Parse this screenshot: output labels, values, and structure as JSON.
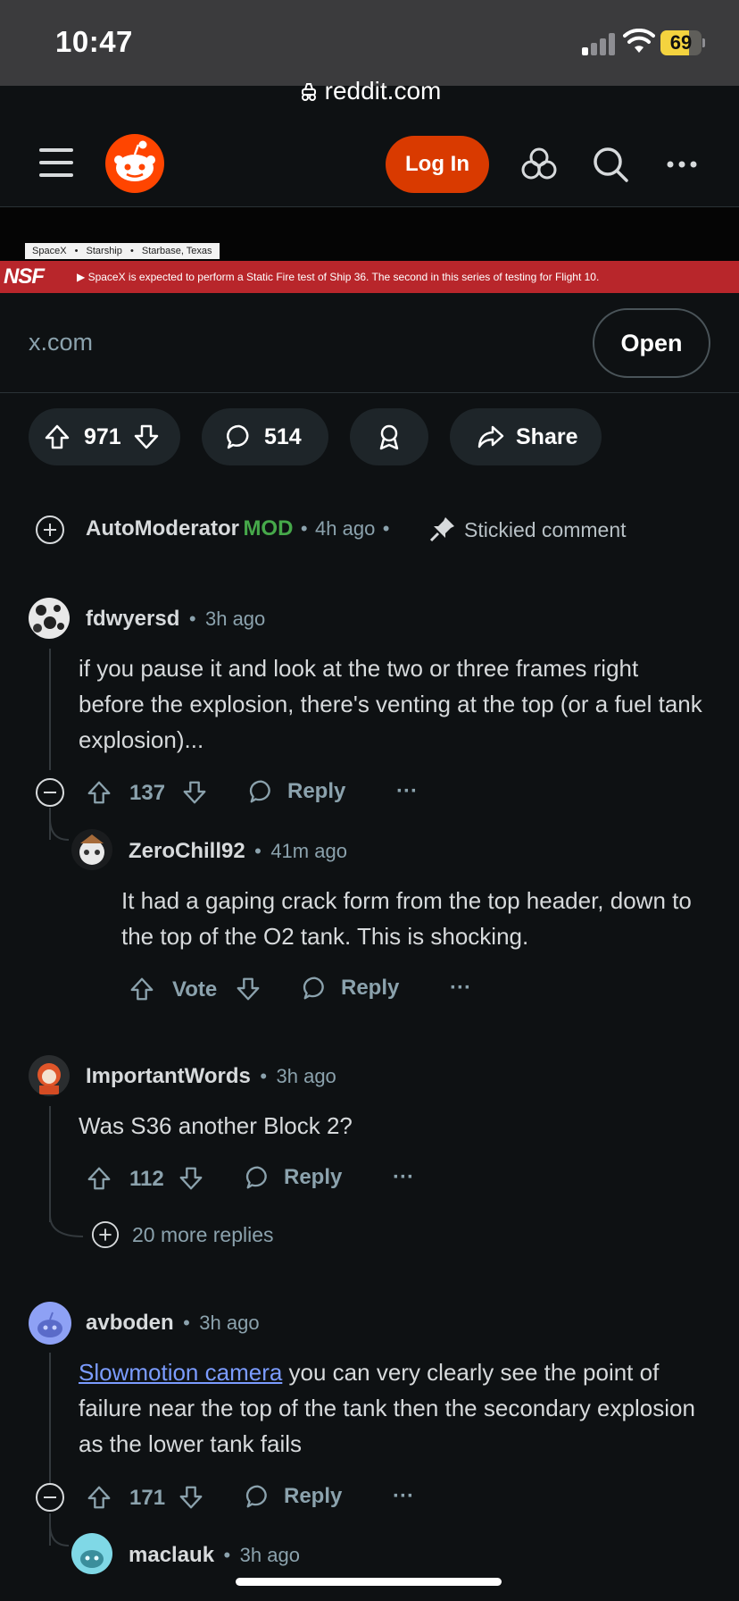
{
  "status_bar": {
    "time": "10:47",
    "battery": "69",
    "battery_color": "#f4d33f"
  },
  "browser": {
    "url": "reddit.com"
  },
  "nav": {
    "login_label": "Log In",
    "logo_color": "#ff4500"
  },
  "video": {
    "tags": [
      "SpaceX",
      "Starship",
      "Starbase, Texas"
    ],
    "tag_separator": "•",
    "logo_text": "NSF",
    "banner": "SpaceX is expected to perform a Static Fire test of Ship 36. The second in this series of testing for Flight 10."
  },
  "link": {
    "domain": "x.com",
    "open_label": "Open"
  },
  "actions": {
    "votes": "971",
    "comments": "514",
    "share_label": "Share"
  },
  "comments": {
    "automod": {
      "author": "AutoModerator",
      "badge": "MOD",
      "time": "4h ago",
      "note": "Stickied comment"
    },
    "c1": {
      "author": "fdwyersd",
      "time": "3h ago",
      "body": "if you pause it and look at the two or three frames right before the explosion, there's venting at the top (or a fuel tank explosion)...",
      "votes": "137",
      "reply_label": "Reply"
    },
    "c1r1": {
      "author": "ZeroChill92",
      "time": "41m ago",
      "body": "It had a gaping crack form from the top header, down to the top of the O2 tank. This is shocking.",
      "vote_label": "Vote",
      "reply_label": "Reply"
    },
    "c2": {
      "author": "ImportantWords",
      "time": "3h ago",
      "body": "Was S36 another Block 2?",
      "votes": "112",
      "reply_label": "Reply",
      "more_replies": "20 more replies"
    },
    "c3": {
      "author": "avboden",
      "time": "3h ago",
      "link_text": "Slowmotion camera",
      "body": " you can very clearly see the point of failure near the top of the tank then the secondary explosion as the lower tank fails",
      "votes": "171",
      "reply_label": "Reply"
    },
    "c3r1": {
      "author": "maclauk",
      "time": "3h ago"
    }
  },
  "separators": {
    "dot": "•",
    "more": "···"
  }
}
